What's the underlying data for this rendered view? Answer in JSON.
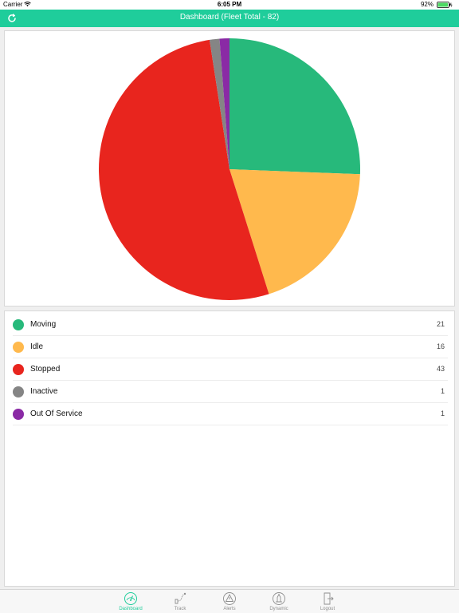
{
  "status_bar": {
    "carrier": "Carrier",
    "time": "6:05 PM",
    "battery": "92%"
  },
  "header": {
    "title": "Dashboard (Fleet Total - 82)",
    "refresh_icon": "refresh-icon"
  },
  "chart_data": {
    "type": "pie",
    "title": "",
    "slices": [
      {
        "label": "Moving",
        "value": 21,
        "color": "#27b97b"
      },
      {
        "label": "Idle",
        "value": 16,
        "color": "#ffb94d"
      },
      {
        "label": "Stopped",
        "value": 43,
        "color": "#e8251e"
      },
      {
        "label": "Inactive",
        "value": 1,
        "color": "#858585"
      },
      {
        "label": "Out Of Service",
        "value": 1,
        "color": "#8a2aa5"
      }
    ]
  },
  "legend": {
    "items": [
      {
        "label": "Moving",
        "count": "21",
        "color": "#27b97b"
      },
      {
        "label": "Idle",
        "count": "16",
        "color": "#ffb94d"
      },
      {
        "label": "Stopped",
        "count": "43",
        "color": "#e8251e"
      },
      {
        "label": "Inactive",
        "count": "1",
        "color": "#858585"
      },
      {
        "label": "Out Of Service",
        "count": "1",
        "color": "#8a2aa5"
      }
    ]
  },
  "tabs": [
    {
      "label": "Dashboard",
      "icon": "speedometer-icon",
      "active": true
    },
    {
      "label": "Track",
      "icon": "route-icon",
      "active": false
    },
    {
      "label": "Alerts",
      "icon": "warning-icon",
      "active": false
    },
    {
      "label": "Dynamic",
      "icon": "dynamic-icon",
      "active": false
    },
    {
      "label": "Logout",
      "icon": "logout-icon",
      "active": false
    }
  ],
  "colors": {
    "accent": "#1fcd9b"
  }
}
